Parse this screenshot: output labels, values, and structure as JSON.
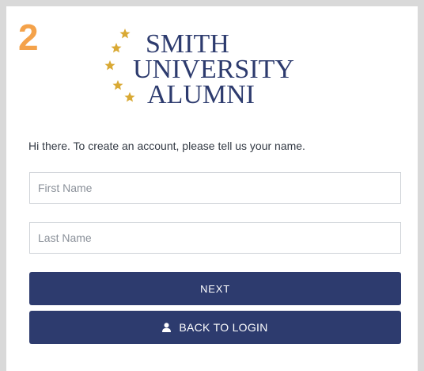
{
  "step": {
    "number": "2"
  },
  "logo": {
    "line1": "SMITH",
    "line2": "UNIVERSITY",
    "line3": "ALUMNI",
    "text_color": "#2d3b6e",
    "star_color": "#d9a934"
  },
  "form": {
    "intro": "Hi there. To create an account, please tell us your name.",
    "first_name": {
      "placeholder": "First Name",
      "value": ""
    },
    "last_name": {
      "placeholder": "Last Name",
      "value": ""
    }
  },
  "buttons": {
    "next_label": "NEXT",
    "back_label": "BACK TO LOGIN",
    "back_icon": "user-icon",
    "color": "#2d3b6e"
  },
  "colors": {
    "step_number": "#f4a24a",
    "background": "#d9d9d9"
  }
}
